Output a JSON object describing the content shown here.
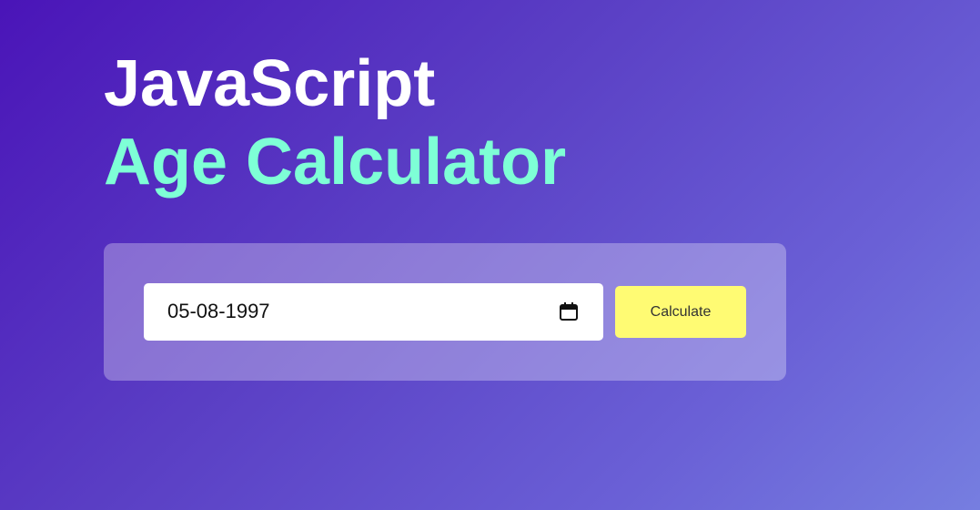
{
  "header": {
    "title_line1": "JavaScript",
    "title_line2": "Age Calculator"
  },
  "form": {
    "date_value": "05-08-1997",
    "calendar_icon": "calendar-icon",
    "calculate_label": "Calculate"
  },
  "colors": {
    "title_primary": "#ffffff",
    "title_accent": "#7effd6",
    "button_bg": "#fffb73",
    "background_start": "#4a14b8",
    "background_end": "#767ee0"
  }
}
